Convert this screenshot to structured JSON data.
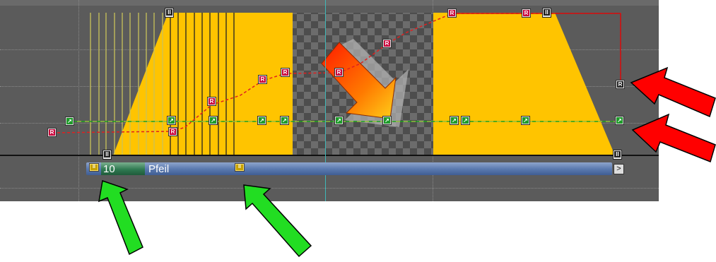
{
  "track": {
    "number": "10",
    "name": "Pfeil"
  },
  "marker_glyphs": {
    "rotation_key": "R",
    "position_key": "↗",
    "pause_key": "II",
    "end_button": ">"
  },
  "colors": {
    "panel_bg": "#5b5b5b",
    "transition_fill": "#ffc400",
    "track_bar": "#5c7bb0",
    "track_number_bg": "#2f7a52",
    "rotation_curve": "#e02020",
    "position_curve": "#1fa01f",
    "playhead": "#3fb7b7",
    "annotation_red": "#ff0000",
    "annotation_green": "#22dd22"
  },
  "icons": [
    "arrow-clip-icon",
    "rotation-key-icon",
    "position-key-icon",
    "pause-marker-icon",
    "end-arrow-icon"
  ]
}
